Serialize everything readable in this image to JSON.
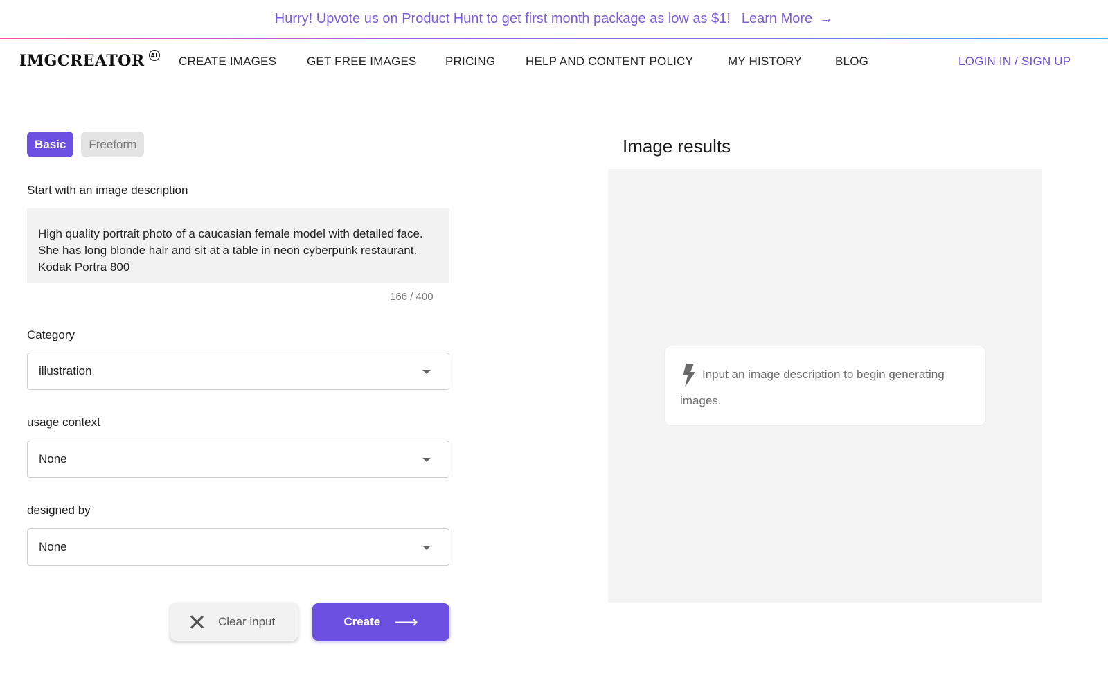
{
  "promo": {
    "text": "Hurry! Upvote us on Product Hunt to get first month package as low as $1!",
    "link_label": "Learn More",
    "link_arrow": "→"
  },
  "nav": {
    "logo": "IMGCREATOR",
    "logo_badge": "AI",
    "items": [
      {
        "label": "CREATE IMAGES"
      },
      {
        "label": "GET FREE IMAGES"
      },
      {
        "label": "PRICING"
      },
      {
        "label": "HELP AND CONTENT POLICY"
      },
      {
        "label": "MY HISTORY"
      },
      {
        "label": "BLOG"
      }
    ],
    "login_label": "LOGIN IN / SIGN UP"
  },
  "form": {
    "tabs": [
      {
        "label": "Basic",
        "active": true
      },
      {
        "label": "Freeform",
        "active": false
      }
    ],
    "description_label": "Start with an image description",
    "description_value": "High quality portrait photo of a caucasian female model with detailed face. She has long blonde hair and sit at a table in neon cyberpunk restaurant. Kodak Portra 800",
    "counter": "166 / 400",
    "category_label": "Category",
    "category_value": "illustration",
    "usage_label": "usage context",
    "usage_value": "None",
    "designer_label": "designed by",
    "designer_value": "None",
    "clear_label": "Clear input",
    "create_label": "Create",
    "create_arrow": "⟶"
  },
  "results": {
    "title": "Image results",
    "hint": "Input an image description to begin generating images."
  },
  "colors": {
    "accent": "#6b4fe0",
    "promo_text": "#7b5cd9",
    "results_bg": "#f4f4f4"
  }
}
